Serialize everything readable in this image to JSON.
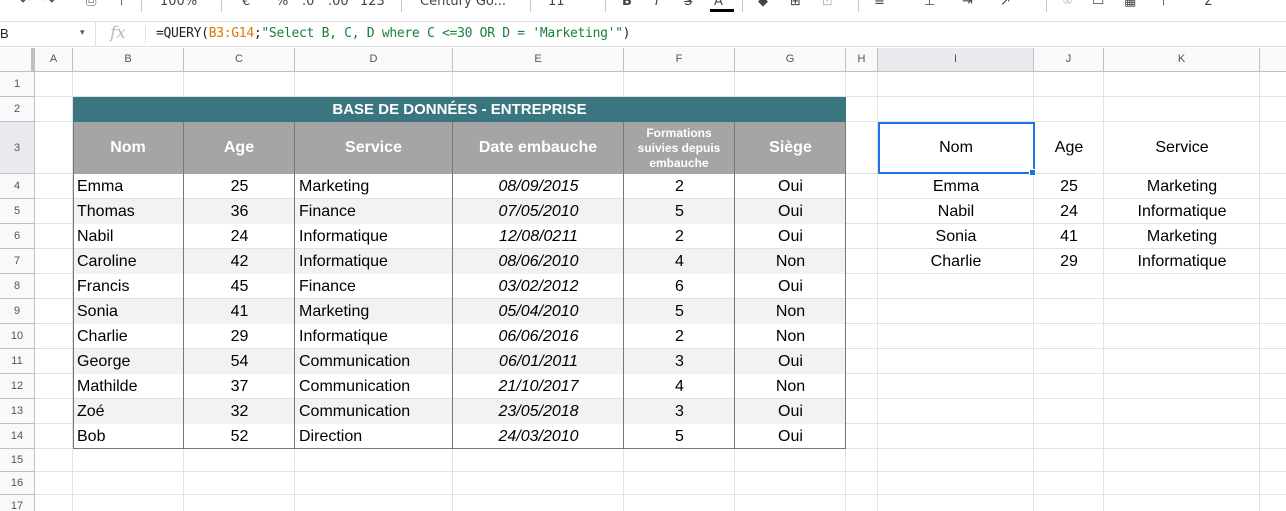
{
  "toolbar": {
    "zoom": "100%",
    "currency": "€",
    "percent": "%",
    "dec_dec": ".0",
    "dec_inc": ".00",
    "more_formats": "123",
    "font": "Century Go...",
    "font_size": "11",
    "bold": "B",
    "italic": "I",
    "strike": "S",
    "text_color": "A"
  },
  "formula_bar": {
    "name_box": "B",
    "fx": "fx",
    "formula_prefix": "=QUERY(",
    "formula_range": "B3:G14",
    "formula_mid": ";",
    "formula_string": "\"Select B, C, D where C <=30 OR D = 'Marketing'\"",
    "formula_suffix": ")"
  },
  "columns": [
    "A",
    "B",
    "C",
    "D",
    "E",
    "F",
    "G",
    "H",
    "I",
    "J",
    "K"
  ],
  "rows": [
    "1",
    "2",
    "3",
    "4",
    "5",
    "6",
    "7",
    "8",
    "9",
    "10",
    "11",
    "12",
    "13",
    "14",
    "15",
    "16",
    "17"
  ],
  "table": {
    "title": "BASE DE DONNÉES - ENTREPRISE",
    "headers": [
      "Nom",
      "Age",
      "Service",
      "Date embauche",
      "Formations suivies depuis embauche",
      "Siège"
    ],
    "rows": [
      [
        "Emma",
        "25",
        "Marketing",
        "08/09/2015",
        "2",
        "Oui"
      ],
      [
        "Thomas",
        "36",
        "Finance",
        "07/05/2010",
        "5",
        "Oui"
      ],
      [
        "Nabil",
        "24",
        "Informatique",
        "12/08/0211",
        "2",
        "Oui"
      ],
      [
        "Caroline",
        "42",
        "Informatique",
        "08/06/2010",
        "4",
        "Non"
      ],
      [
        "Francis",
        "45",
        "Finance",
        "03/02/2012",
        "6",
        "Oui"
      ],
      [
        "Sonia",
        "41",
        "Marketing",
        "05/04/2010",
        "5",
        "Non"
      ],
      [
        "Charlie",
        "29",
        "Informatique",
        "06/06/2016",
        "2",
        "Non"
      ],
      [
        "George",
        "54",
        "Communication",
        "06/01/2011",
        "3",
        "Oui"
      ],
      [
        "Mathilde",
        "37",
        "Communication",
        "21/10/2017",
        "4",
        "Non"
      ],
      [
        "Zoé",
        "32",
        "Communication",
        "23/05/2018",
        "3",
        "Oui"
      ],
      [
        "Bob",
        "52",
        "Direction",
        "24/03/2010",
        "5",
        "Oui"
      ]
    ]
  },
  "result": {
    "headers": [
      "Nom",
      "Age",
      "Service"
    ],
    "rows": [
      [
        "Emma",
        "25",
        "Marketing"
      ],
      [
        "Nabil",
        "24",
        "Informatique"
      ],
      [
        "Sonia",
        "41",
        "Marketing"
      ],
      [
        "Charlie",
        "29",
        "Informatique"
      ]
    ]
  },
  "colors": {
    "title_bg": "#3a7680",
    "header_bg": "#a5a5a5",
    "stripe": "#f2f2f2",
    "selection": "#1a73e8",
    "formula_range": "#e37400",
    "formula_string": "#188038"
  }
}
